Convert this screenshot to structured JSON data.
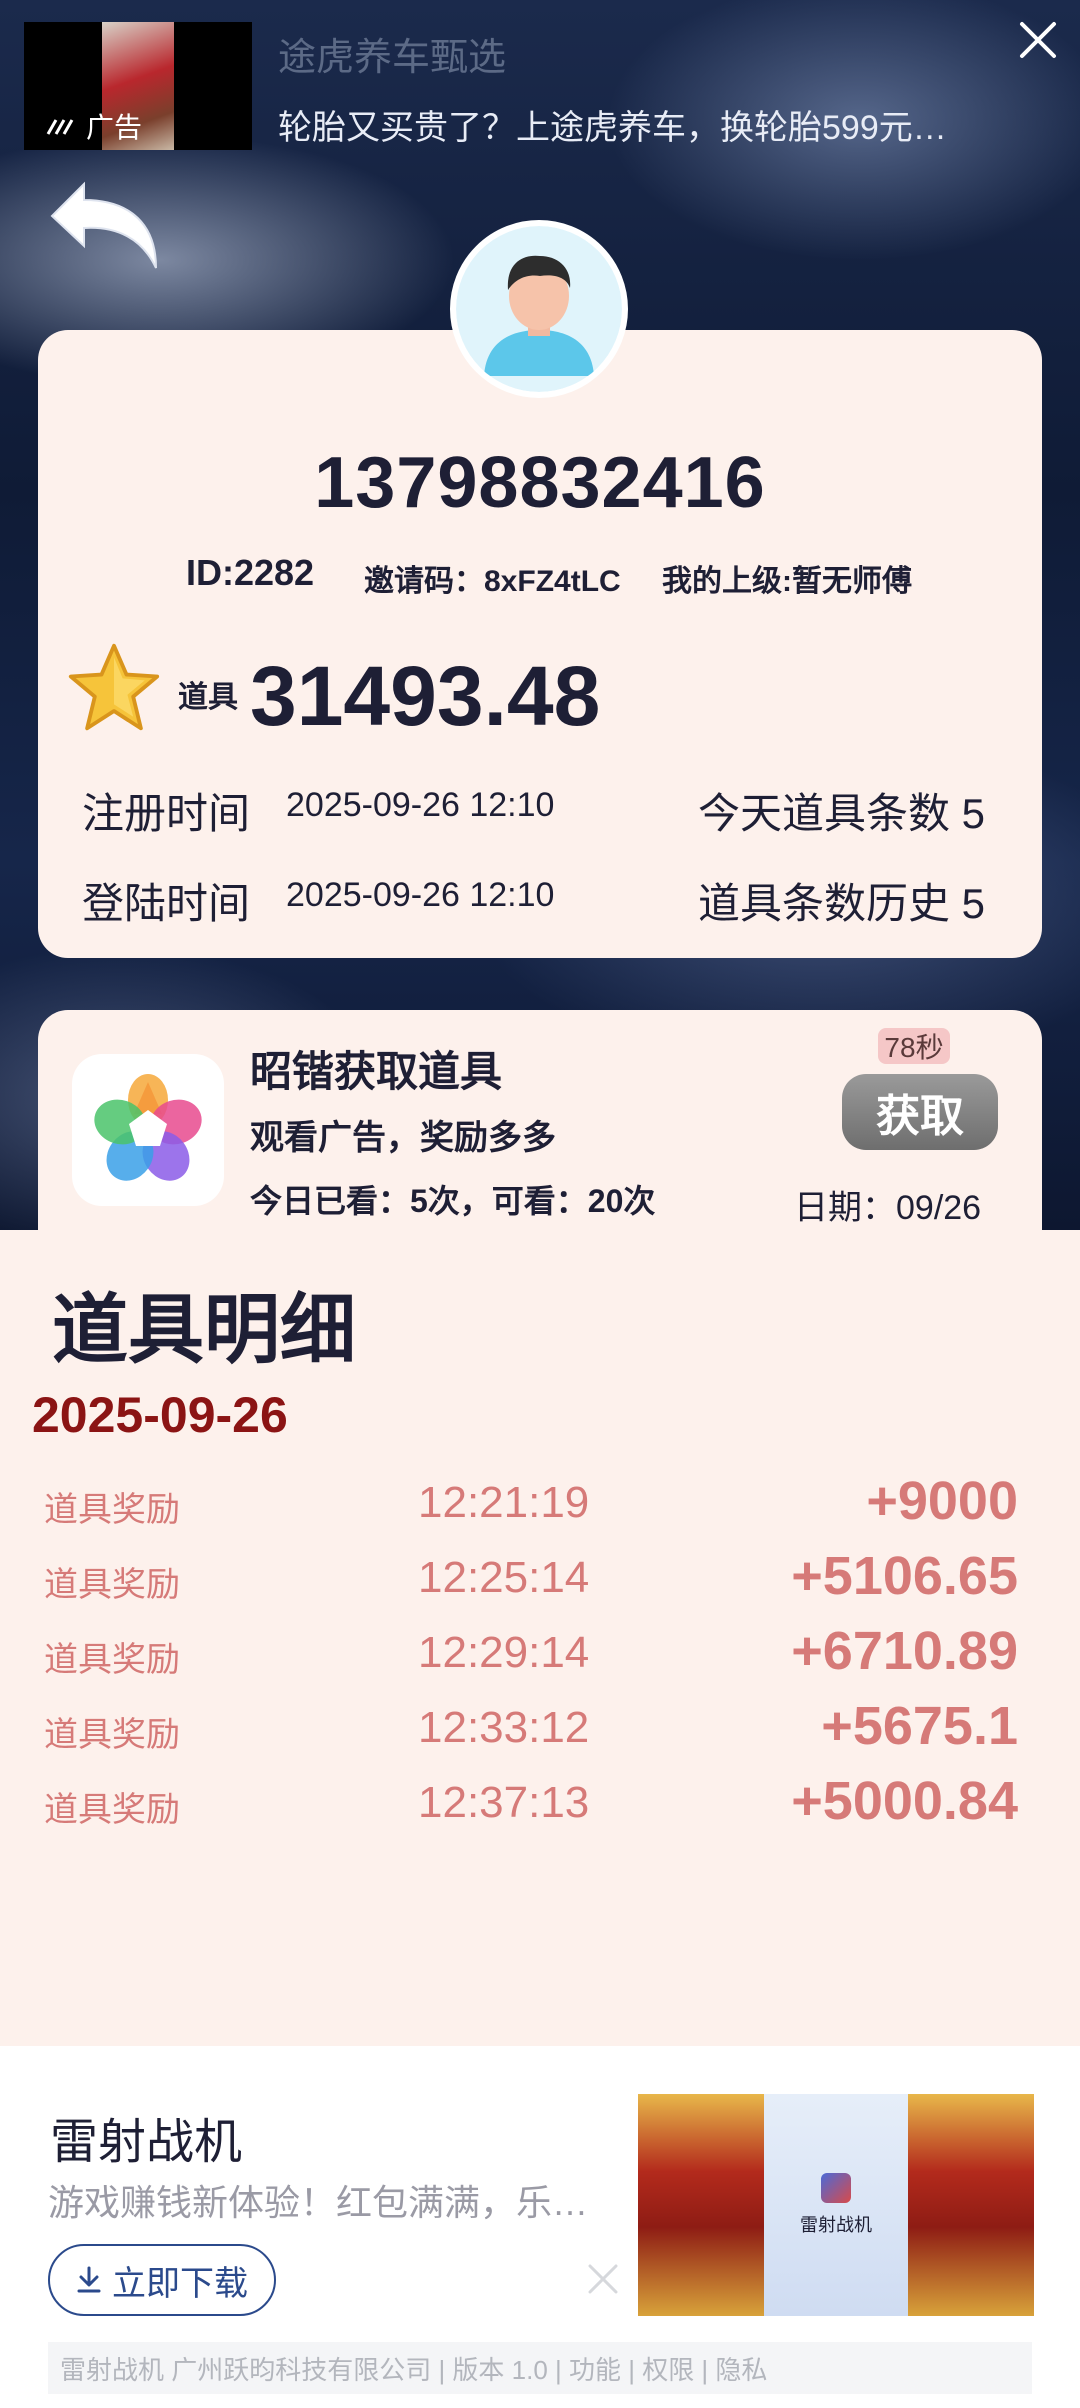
{
  "top_ad": {
    "brand": "途虎养车甄选",
    "text": "轮胎又买贵了？上途虎养车，换轮胎599元…",
    "label": "广告",
    "close_icon": "close-icon"
  },
  "back": {
    "icon": "back-arrow-icon"
  },
  "profile": {
    "phone": "13798832416",
    "id": "ID:2282",
    "invite": "邀请码：8xFZ4tLC",
    "superior": "我的上级:暂无师傅",
    "prop_label": "道具",
    "prop_value": "31493.48",
    "register_label": "注册时间",
    "register_time": "2025-09-26 12:10",
    "login_label": "登陆时间",
    "login_time": "2025-09-26 12:10",
    "today_count": "今天道具条数 5",
    "history_count": "道具条数历史 5"
  },
  "task": {
    "title": "昭锴获取道具",
    "subtitle": "观看广告，奖励多多",
    "count": "今日已看：5次，可看：20次",
    "timer": "78秒",
    "button": "获取",
    "date": "日期：09/26"
  },
  "detail": {
    "title": "道具明细",
    "date": "2025-09-26",
    "rows": [
      {
        "label": "道具奖励",
        "time": "12:21:19",
        "amount": "+9000"
      },
      {
        "label": "道具奖励",
        "time": "12:25:14",
        "amount": "+5106.65"
      },
      {
        "label": "道具奖励",
        "time": "12:29:14",
        "amount": "+6710.89"
      },
      {
        "label": "道具奖励",
        "time": "12:33:12",
        "amount": "+5675.1"
      },
      {
        "label": "道具奖励",
        "time": "12:37:13",
        "amount": "+5000.84"
      }
    ]
  },
  "bottom_ad": {
    "title": "雷射战机",
    "desc": "游戏赚钱新体验！红包满满，乐…",
    "download": "立即下载",
    "image_text": "雷射战机",
    "footer": "雷射战机 广州跃昀科技有限公司 | 版本 1.0 | 功能 | 权限 | 隐私"
  }
}
